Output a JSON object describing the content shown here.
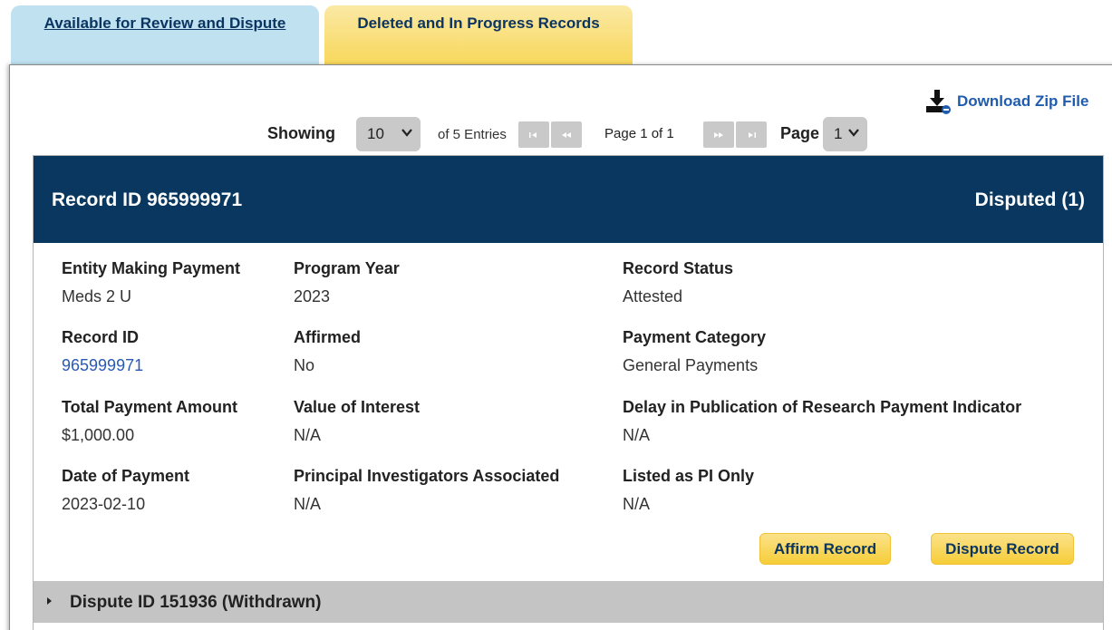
{
  "tabs": {
    "review_label": "Available for Review and Dispute",
    "deleted_label": "Deleted and In Progress Records"
  },
  "download": {
    "label": "Download Zip File",
    "icon": "download-icon"
  },
  "pagination": {
    "showing_label": "Showing",
    "page_size": "10",
    "of_entries": "of 5 Entries",
    "page_of": "Page 1 of 1",
    "page_label": "Page",
    "page_value": "1"
  },
  "record": {
    "header_title": "Record ID 965999971",
    "header_status": "Disputed (1)",
    "fields": {
      "entity_label": "Entity Making Payment",
      "entity_value": "Meds 2 U",
      "program_year_label": "Program Year",
      "program_year_value": "2023",
      "record_status_label": "Record Status",
      "record_status_value": "Attested",
      "record_id_label": "Record ID",
      "record_id_value": "965999971",
      "affirmed_label": "Affirmed",
      "affirmed_value": "No",
      "payment_category_label": "Payment Category",
      "payment_category_value": "General Payments",
      "total_payment_label": "Total Payment Amount",
      "total_payment_value": "$1,000.00",
      "value_interest_label": "Value of Interest",
      "value_interest_value": "N/A",
      "delay_label": "Delay in Publication of Research Payment Indicator",
      "delay_value": "N/A",
      "date_label": "Date of Payment",
      "date_value": "2023-02-10",
      "pi_assoc_label": "Principal Investigators Associated",
      "pi_assoc_value": "N/A",
      "pi_only_label": "Listed as PI Only",
      "pi_only_value": "N/A"
    },
    "affirm_button": "Affirm Record",
    "dispute_button": "Dispute Record"
  },
  "dispute": {
    "title": "Dispute ID 151936 (Withdrawn)"
  },
  "colors": {
    "header_bg": "#09375f",
    "tab_review_bg": "#bfe1f0",
    "tab_deleted_bg": "#f8d75a",
    "button_bg": "#f6cd38",
    "link": "#2a59b5"
  }
}
